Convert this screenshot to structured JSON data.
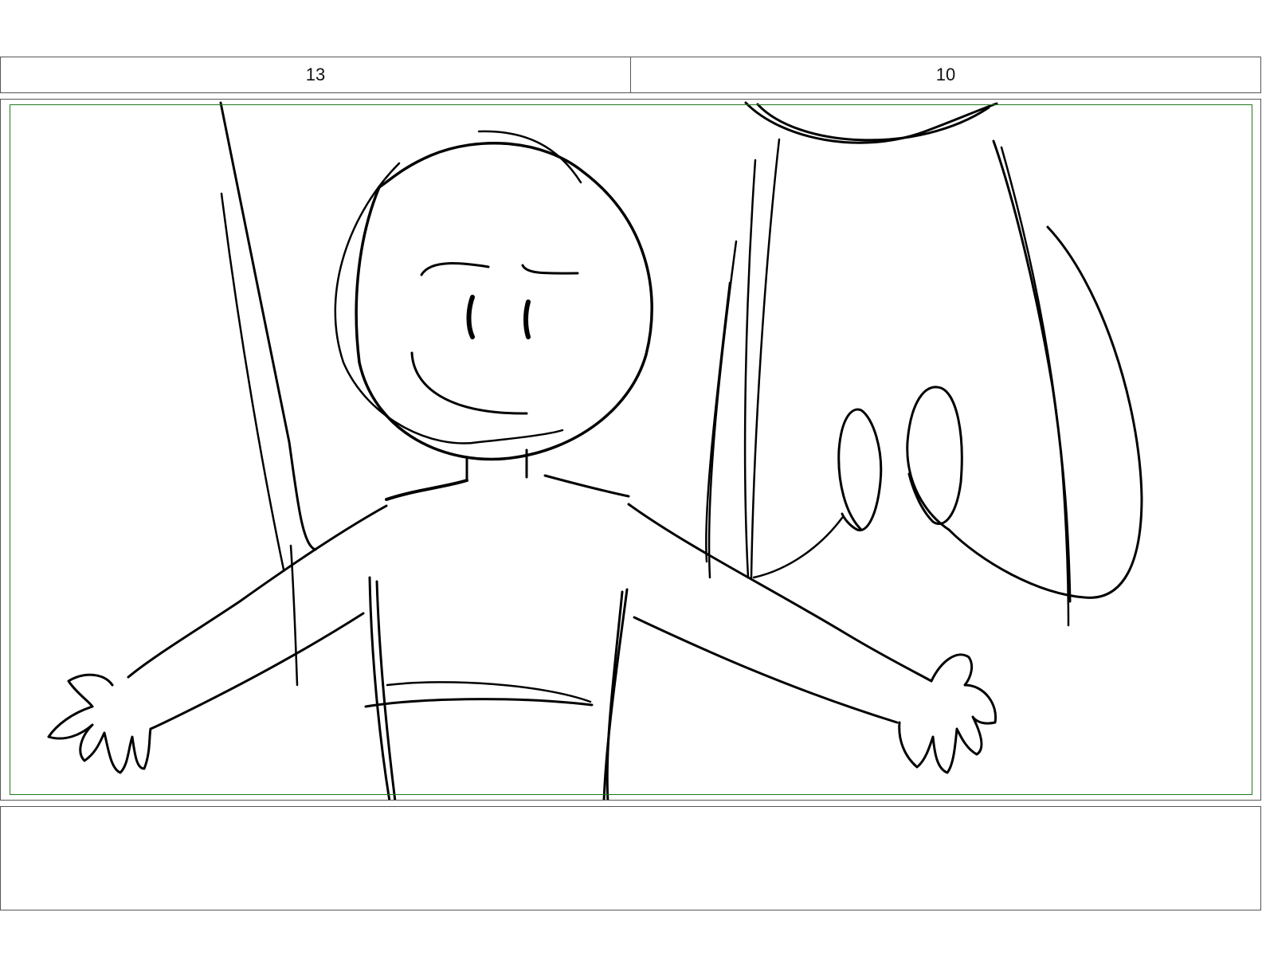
{
  "header": {
    "scene": "13",
    "panel": "10"
  },
  "notes": {
    "text": ""
  },
  "colors": {
    "border": "#555555",
    "safe_frame": "#1f7a1f",
    "ink": "#000000"
  }
}
